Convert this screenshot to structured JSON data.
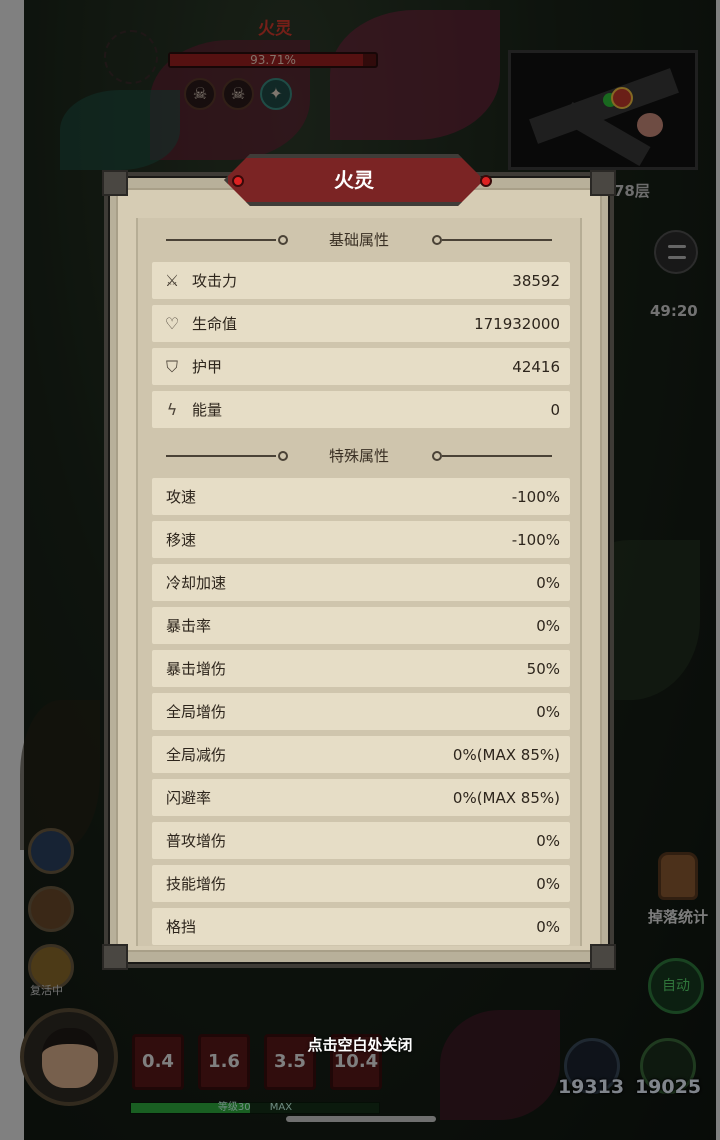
{
  "boss": {
    "name": "火灵",
    "hp_percent_text": "93.71%",
    "hp_fraction": 0.9371
  },
  "hud": {
    "floor": "78层",
    "timer": "49:20",
    "loot_label": "掉落统计",
    "auto_label": "自动",
    "revive_label": "复活中",
    "close_hint": "点击空白处关闭",
    "xp_text": "等级30",
    "xp_max": "MAX",
    "skills": [
      "0.4",
      "1.6",
      "3.5",
      "10.4"
    ],
    "potions": [
      "19313",
      "19025"
    ]
  },
  "panel": {
    "title": "火灵",
    "basic_header": "基础属性",
    "special_header": "特殊属性",
    "basic": [
      {
        "icon": "sword-icon",
        "glyph": "⚔",
        "label": "攻击力",
        "value": "38592"
      },
      {
        "icon": "heart-icon",
        "glyph": "♡",
        "label": "生命值",
        "value": "171932000"
      },
      {
        "icon": "shield-icon",
        "glyph": "⛉",
        "label": "护甲",
        "value": "42416"
      },
      {
        "icon": "energy-icon",
        "glyph": "ϟ",
        "label": "能量",
        "value": "0"
      }
    ],
    "special": [
      {
        "label": "攻速",
        "value": "-100%"
      },
      {
        "label": "移速",
        "value": "-100%"
      },
      {
        "label": "冷却加速",
        "value": "0%"
      },
      {
        "label": "暴击率",
        "value": "0%"
      },
      {
        "label": "暴击增伤",
        "value": "50%"
      },
      {
        "label": "全局增伤",
        "value": "0%"
      },
      {
        "label": "全局减伤",
        "value": "0%(MAX 85%)"
      },
      {
        "label": "闪避率",
        "value": "0%(MAX 85%)"
      },
      {
        "label": "普攻增伤",
        "value": "0%"
      },
      {
        "label": "技能增伤",
        "value": "0%"
      },
      {
        "label": "格挡",
        "value": "0%"
      }
    ]
  },
  "colors": {
    "banner": "#7b2424",
    "parchment": "#d6ccb4",
    "row": "#e6ddc6",
    "boss_name": "#d33a2c"
  }
}
